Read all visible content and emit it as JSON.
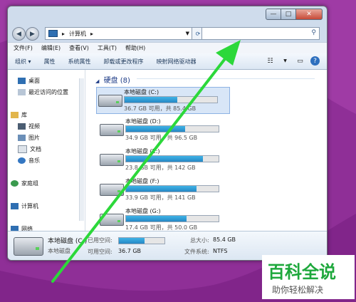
{
  "window": {
    "title_controls": {
      "min": "—",
      "max": "□",
      "close": "✕"
    }
  },
  "address": {
    "crumb_sep": "▸",
    "location": "计算机",
    "search_placeholder": ""
  },
  "menu": [
    "文件(F)",
    "编辑(E)",
    "查看(V)",
    "工具(T)",
    "帮助(H)"
  ],
  "toolbar": [
    "组织 ▾",
    "属性",
    "系统属性",
    "卸载或更改程序",
    "映射网络驱动器"
  ],
  "sidebar": {
    "favorites": [
      "桌面",
      "最近访问的位置"
    ],
    "library": "库",
    "library_items": [
      "视频",
      "图片",
      "文档",
      "音乐"
    ],
    "homegroup": "家庭组",
    "computer": "计算机",
    "network": "网络"
  },
  "content": {
    "group_title": "硬盘 (8)",
    "drives": [
      {
        "name": "本地磁盘 (C:)",
        "info": "36.7 GB 可用，共 85.4 GB",
        "used": 0.57
      },
      {
        "name": "本地磁盘 (D:)",
        "info": "34.9 GB 可用，共 96.5 GB",
        "used": 0.64
      },
      {
        "name": "本地磁盘 (E:)",
        "info": "23.8 GB 可用，共 142 GB",
        "used": 0.83
      },
      {
        "name": "本地磁盘 (F:)",
        "info": "33.9 GB 可用，共 141 GB",
        "used": 0.76
      },
      {
        "name": "本地磁盘 (G:)",
        "info": "17.4 GB 可用，共 50.0 GB",
        "used": 0.65
      }
    ]
  },
  "details": {
    "name": "本地磁盘 (C:)",
    "type": "本地磁盘",
    "used_label": "已用空间:",
    "free_label": "可用空间:",
    "free_value": "36.7 GB",
    "total_label": "总大小:",
    "total_value": "85.4 GB",
    "fs_label": "文件系统:",
    "fs_value": "NTFS",
    "used": 0.57
  },
  "watermark": {
    "title": "百科全说",
    "subtitle": "助你轻松解决"
  }
}
